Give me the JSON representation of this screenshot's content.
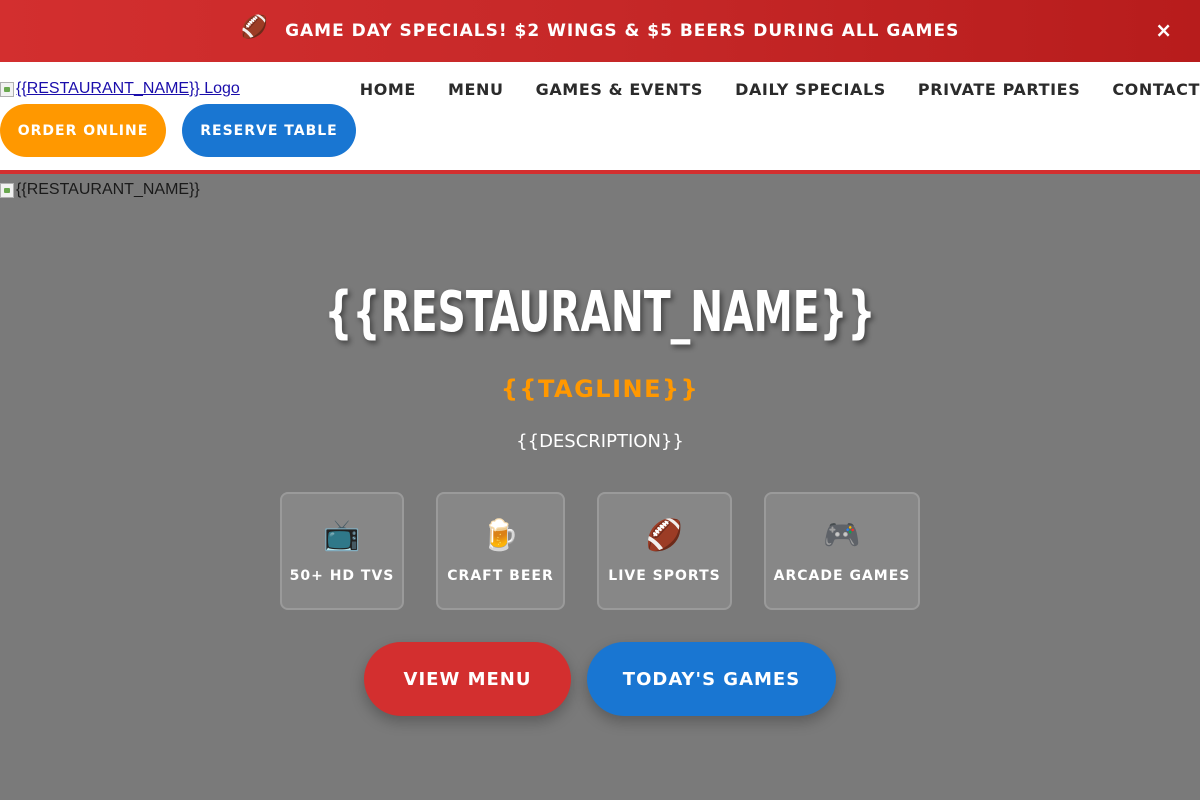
{
  "promo": {
    "emoji": "🏈",
    "text": "GAME DAY SPECIALS! $2 WINGS & $5 BEERS DURING ALL GAMES",
    "close": "×"
  },
  "header": {
    "logo_alt": "{{RESTAURANT_NAME}} Logo",
    "nav": [
      "HOME",
      "MENU",
      "GAMES & EVENTS",
      "DAILY SPECIALS",
      "PRIVATE PARTIES",
      "CONTACT"
    ],
    "order_button": "ORDER ONLINE",
    "reserve_button": "RESERVE TABLE"
  },
  "hero": {
    "image_alt": "{{RESTAURANT_NAME}}",
    "title": "{{RESTAURANT_NAME}}",
    "tagline": "{{TAGLINE}}",
    "description": "{{DESCRIPTION}}",
    "features": [
      {
        "icon": "📺",
        "icon_name": "tv-icon",
        "label": "50+ HD TVS"
      },
      {
        "icon": "🍺",
        "icon_name": "beer-icon",
        "label": "CRAFT BEER"
      },
      {
        "icon": "🏈",
        "icon_name": "football-icon",
        "label": "LIVE SPORTS"
      },
      {
        "icon": "🎮",
        "icon_name": "game-controller-icon",
        "label": "ARCADE GAMES"
      }
    ],
    "view_menu_button": "VIEW MENU",
    "todays_games_button": "TODAY'S GAMES"
  },
  "colors": {
    "banner_red": "#d32f2f",
    "accent_orange": "#ff9800",
    "accent_blue": "#1976d2",
    "hero_gray": "#7a7a7a"
  }
}
